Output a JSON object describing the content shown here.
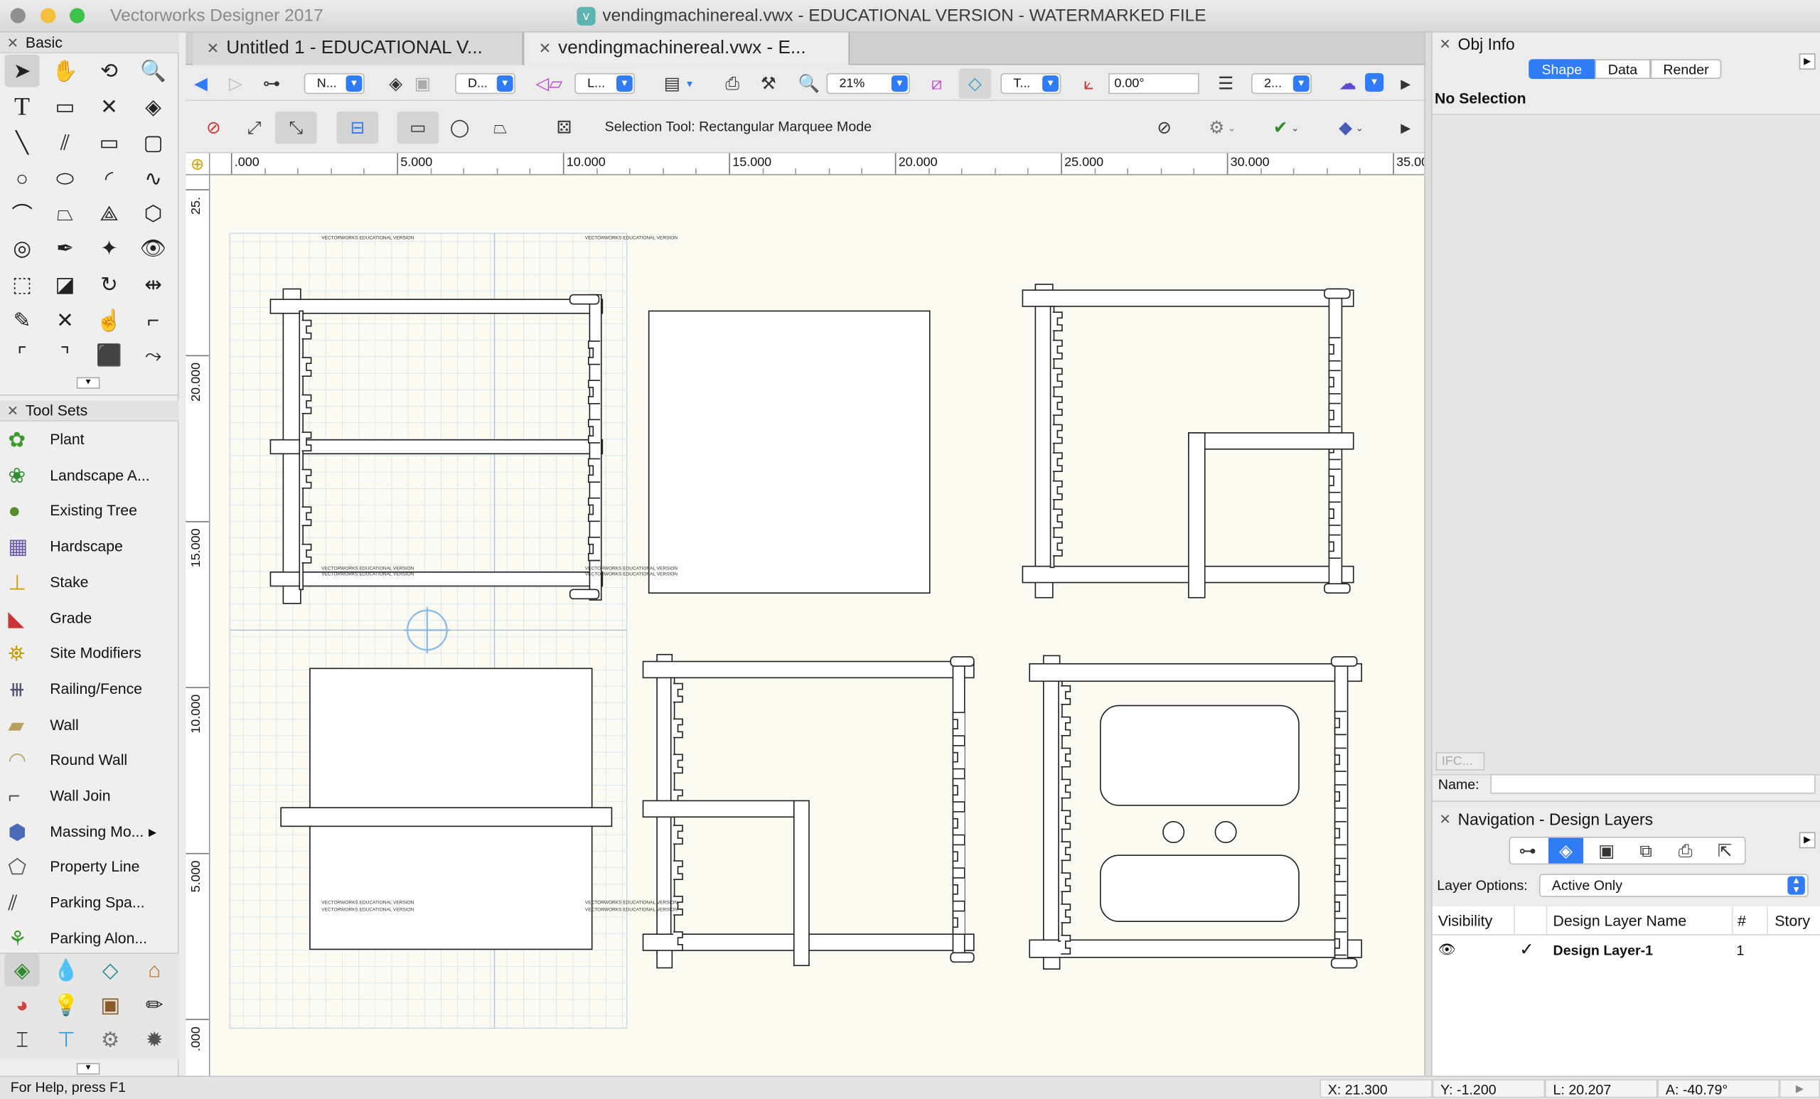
{
  "window": {
    "app_title": "Vectorworks Designer 2017",
    "doc_title": "vendingmachinereal.vwx - EDUCATIONAL VERSION - WATERMARKED FILE",
    "traffic_lights": {
      "close": "#8f8f8f",
      "minimize": "#f5bf3c",
      "zoom": "#3dc34a"
    }
  },
  "tabs": [
    {
      "label": "Untitled 1 - EDUCATIONAL V..."
    },
    {
      "label": "vendingmachinereal.vwx - E..."
    }
  ],
  "view_bar": {
    "class_dd": "N...",
    "layer_dd": "D...",
    "view_dd": "L...",
    "zoom": "21%",
    "render_dd": "T...",
    "rotation": "0.00°",
    "story_dd": "2..."
  },
  "tool_bar": {
    "mode_text": "Selection Tool: Rectangular Marquee Mode"
  },
  "basic_palette": {
    "title": "Basic"
  },
  "tool_sets": {
    "title": "Tool Sets",
    "items": [
      {
        "label": "Plant",
        "icon": "plant-icon"
      },
      {
        "label": "Landscape A...",
        "icon": "landscape-area-icon"
      },
      {
        "label": "Existing Tree",
        "icon": "existing-tree-icon"
      },
      {
        "label": "Hardscape",
        "icon": "hardscape-icon"
      },
      {
        "label": "Stake",
        "icon": "stake-icon"
      },
      {
        "label": "Grade",
        "icon": "grade-icon"
      },
      {
        "label": "Site Modifiers",
        "icon": "site-modifiers-icon"
      },
      {
        "label": "Railing/Fence",
        "icon": "railing-fence-icon"
      },
      {
        "label": "Wall",
        "icon": "wall-icon"
      },
      {
        "label": "Round Wall",
        "icon": "round-wall-icon"
      },
      {
        "label": "Wall Join",
        "icon": "wall-join-icon"
      },
      {
        "label": "Massing Mo...",
        "icon": "massing-model-icon"
      },
      {
        "label": "Property Line",
        "icon": "property-line-icon"
      },
      {
        "label": "Parking Spa...",
        "icon": "parking-space-icon"
      },
      {
        "label": "Parking Alon...",
        "icon": "parking-along-path-icon"
      }
    ]
  },
  "ruler": {
    "top": [
      ".000",
      "5.000",
      "10.000",
      "15.000",
      "20.000",
      "25.000",
      "30.000",
      "35.00"
    ],
    "left": [
      "25.",
      "20.000",
      "15.000",
      "10.000",
      "5.000",
      ".000"
    ]
  },
  "watermark": "VECTORWORKS EDUCATIONAL VERSION",
  "obj_info": {
    "title": "Obj Info",
    "tabs": [
      "Shape",
      "Data",
      "Render"
    ],
    "active_tab": "Shape",
    "selection_text": "No Selection",
    "ifc_button": "IFC...",
    "name_label": "Name:",
    "name_value": ""
  },
  "navigation": {
    "title": "Navigation - Design Layers",
    "layer_options_label": "Layer Options:",
    "layer_options_value": "Active Only",
    "columns": [
      "Visibility",
      "Design Layer Name",
      "#",
      "Story"
    ],
    "rows": [
      {
        "check": "✓",
        "name": "Design Layer-1",
        "number": "1"
      }
    ]
  },
  "status": {
    "help": "For Help, press F1",
    "x": "X:  21.300",
    "y": "Y:  -1.200",
    "l": "L:  20.207",
    "a": "A:  -40.79°"
  },
  "colors": {
    "accent": "#2f7cf6",
    "grid": "#c9def0",
    "canvas": "#fbfbf1"
  }
}
